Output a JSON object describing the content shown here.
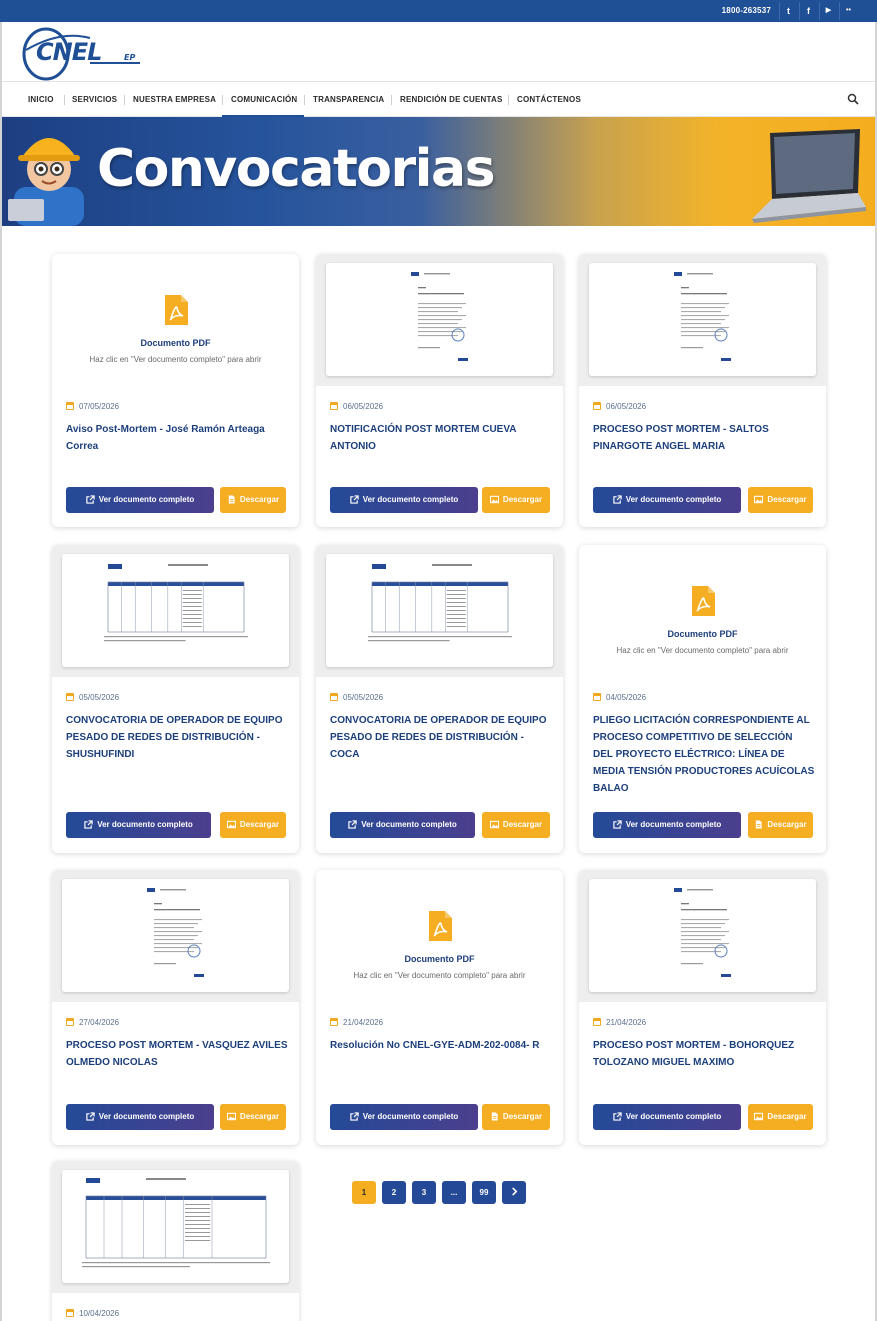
{
  "topbar": {
    "phone": "1800-263537",
    "social": [
      {
        "icon": "twitter-icon",
        "glyph": "t"
      },
      {
        "icon": "facebook-icon",
        "glyph": "f"
      },
      {
        "icon": "youtube-icon",
        "glyph": "▶"
      },
      {
        "icon": "flickr-icon",
        "glyph": "••"
      }
    ]
  },
  "logo": {
    "text": "CNEL",
    "suffix": "EP"
  },
  "nav": {
    "items": [
      "INICIO",
      "SERVICIOS",
      "NUESTRA EMPRESA",
      "COMUNICACIÓN",
      "TRANSPARENCIA",
      "RENDICIÓN DE CUENTAS",
      "CONTÁCTENOS"
    ],
    "active": "COMUNICACIÓN"
  },
  "banner": {
    "title": "Convocatorias"
  },
  "labels": {
    "view": "Ver documento completo",
    "download": "Descargar",
    "pdf_label": "Documento PDF",
    "pdf_hint": "Haz clic en \"Ver documento completo\" para abrir"
  },
  "cards": [
    {
      "date": "07/05/2026",
      "title": "Aviso Post-Mortem - José Ramón Arteaga Correa",
      "preview": "pdf",
      "download_icon": "file"
    },
    {
      "date": "06/05/2026",
      "title": "NOTIFICACIÓN POST MORTEM CUEVA ANTONIO",
      "preview": "letter",
      "download_icon": "image"
    },
    {
      "date": "06/05/2026",
      "title": "PROCESO POST MORTEM - SALTOS PINARGOTE ANGEL MARIA",
      "preview": "letter",
      "download_icon": "image"
    },
    {
      "date": "05/05/2026",
      "title": "CONVOCATORIA DE OPERADOR DE EQUIPO PESADO DE REDES DE DISTRIBUCIÓN - SHUSHUFINDI",
      "preview": "table",
      "download_icon": "image"
    },
    {
      "date": "05/05/2026",
      "title": "CONVOCATORIA DE OPERADOR DE EQUIPO PESADO DE REDES DE DISTRIBUCIÓN - COCA",
      "preview": "table",
      "download_icon": "image"
    },
    {
      "date": "04/05/2026",
      "title": "PLIEGO LICITACIÓN CORRESPONDIENTE AL PROCESO COMPETITIVO DE SELECCIÓN DEL PROYECTO ELÉCTRICO: LÍNEA DE MEDIA TENSIÓN PRODUCTORES ACUÍCOLAS BALAO",
      "preview": "pdf",
      "download_icon": "file"
    },
    {
      "date": "27/04/2026",
      "title": "PROCESO POST MORTEM - VASQUEZ AVILES OLMEDO NICOLAS",
      "preview": "letter",
      "download_icon": "image"
    },
    {
      "date": "21/04/2026",
      "title": "Resolución No CNEL-GYE-ADM-202-0084- R",
      "preview": "pdf",
      "download_icon": "file"
    },
    {
      "date": "21/04/2026",
      "title": "PROCESO POST MORTEM - BOHORQUEZ TOLOZANO MIGUEL MAXIMO",
      "preview": "letter",
      "download_icon": "image"
    },
    {
      "date": "10/04/2026",
      "title": "",
      "preview": "table-large",
      "download_icon": "image"
    }
  ],
  "pagination": {
    "pages": [
      "1",
      "2",
      "3",
      "...",
      "99"
    ],
    "current": "1",
    "next_icon": "chevron-right-icon"
  },
  "colors": {
    "primary": "#1f4f95",
    "accent": "#f5ad22",
    "title": "#1c3f7c"
  }
}
